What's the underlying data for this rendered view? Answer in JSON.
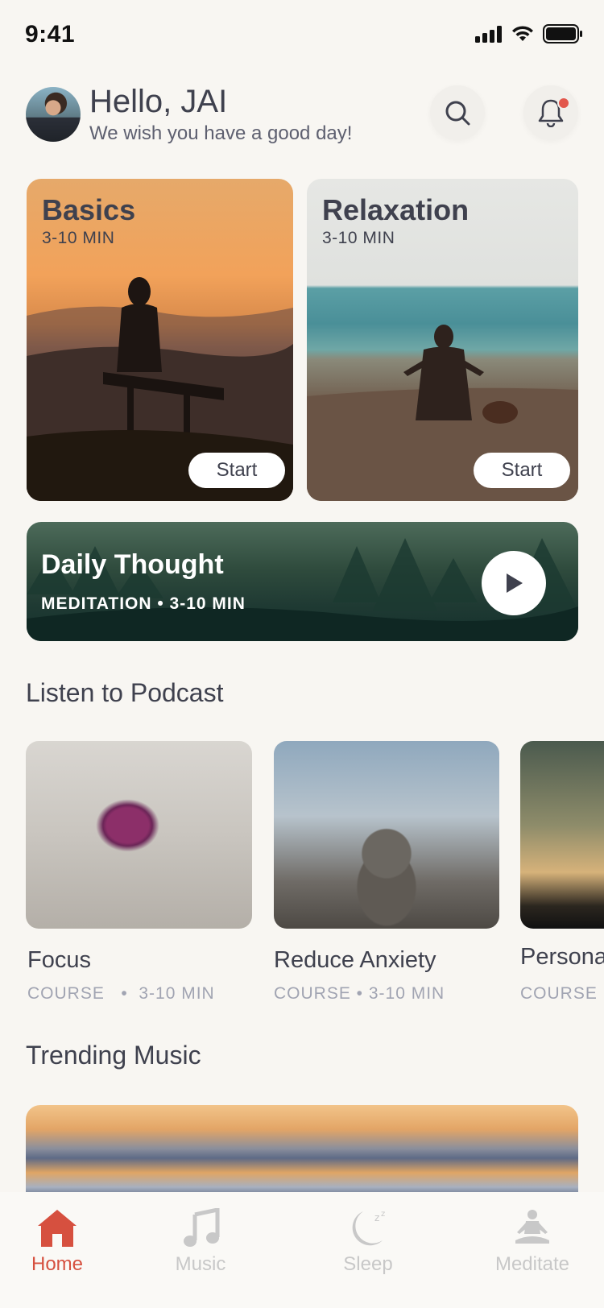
{
  "status": {
    "time": "9:41"
  },
  "header": {
    "greeting_prefix": "Hello,",
    "name": "JAI",
    "subtitle": "We wish you have a good day!"
  },
  "cards": [
    {
      "title": "Basics",
      "duration": "3-10 MIN",
      "button": "Start"
    },
    {
      "title": "Relaxation",
      "duration": "3-10 MIN",
      "button": "Start"
    }
  ],
  "daily": {
    "title": "Daily Thought",
    "meta": "MEDITATION • 3-10 MIN"
  },
  "podcast": {
    "section_title": "Listen to Podcast",
    "items": [
      {
        "name": "Focus",
        "meta": "COURSE   •  3-10 MIN"
      },
      {
        "name": "Reduce Anxiety",
        "meta": "COURSE • 3-10 MIN"
      },
      {
        "name": "Persona",
        "meta": "COURSE"
      }
    ]
  },
  "trending": {
    "section_title": "Trending Music"
  },
  "tabs": [
    {
      "label": "Home",
      "icon": "home-icon",
      "active": true
    },
    {
      "label": "Music",
      "icon": "music-icon",
      "active": false
    },
    {
      "label": "Sleep",
      "icon": "sleep-icon",
      "active": false
    },
    {
      "label": "Meditate",
      "icon": "meditate-icon",
      "active": false
    }
  ],
  "colors": {
    "accent": "#d6503f",
    "text": "#3f414e",
    "muted": "#a1a4b2",
    "background": "#f8f6f2"
  }
}
